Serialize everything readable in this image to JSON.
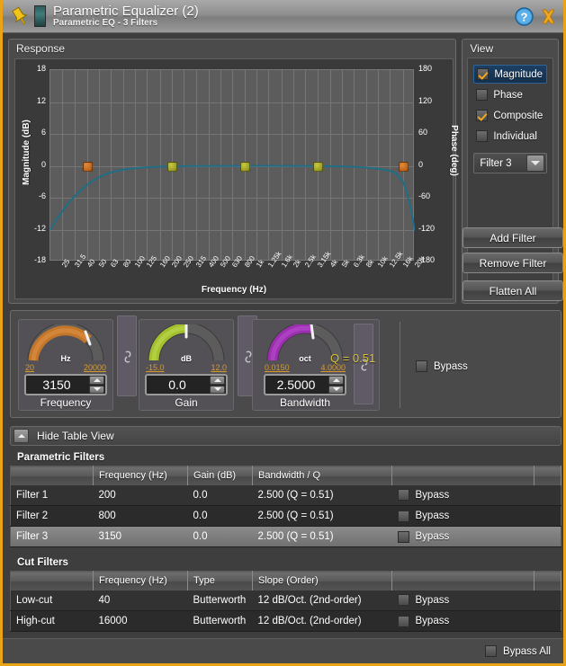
{
  "titlebar": {
    "title": "Parametric Equalizer (2)",
    "subtitle": "Parametric EQ - 3 Filters",
    "help_icon": "help-icon",
    "close_icon": "close-icon",
    "pin_icon": "pin-icon"
  },
  "response": {
    "panel_title": "Response"
  },
  "view": {
    "panel_title": "View",
    "items": [
      {
        "label": "Magnitude",
        "checked": true,
        "selected": true
      },
      {
        "label": "Phase",
        "checked": false,
        "selected": false
      },
      {
        "label": "Composite",
        "checked": true,
        "selected": false
      },
      {
        "label": "Individual",
        "checked": false,
        "selected": false
      }
    ],
    "filter_select": "Filter 3"
  },
  "buttons": {
    "add_filter": "Add Filter",
    "remove_filter": "Remove Filter",
    "flatten_all": "Flatten All"
  },
  "knobs": {
    "frequency": {
      "name": "Frequency",
      "unit": "Hz",
      "min": "20",
      "max": "20000",
      "value": "3150",
      "arc_color": "#c2762a",
      "fill_ratio": 0.66
    },
    "gain": {
      "name": "Gain",
      "unit": "dB",
      "min": "-15.0",
      "max": "12.0",
      "value": "0.0",
      "arc_color": "#a3bf2e",
      "fill_ratio": 0.55
    },
    "bandwidth": {
      "name": "Bandwidth",
      "unit": "oct",
      "min": "0.0150",
      "max": "4.0000",
      "value": "2.5000",
      "arc_color": "#9b2fb0",
      "fill_ratio": 0.62
    },
    "q_readout": "Q = 0.51",
    "bypass_label": "Bypass",
    "bypass_checked": false,
    "link_icon": "link-icon"
  },
  "table_view": {
    "toggle_label": "Hide Table View",
    "collapse_icon": "chevron-up-icon",
    "parametric": {
      "caption": "Parametric Filters",
      "headers": [
        "",
        "Frequency (Hz)",
        "Gain (dB)",
        "Bandwidth / Q",
        "",
        ""
      ],
      "rows": [
        {
          "name": "Filter 1",
          "frequency": "200",
          "gain": "0.0",
          "bandwidth": "2.500 (Q = 0.51)",
          "bypass": "Bypass",
          "bypass_checked": false,
          "selected": false
        },
        {
          "name": "Filter 2",
          "frequency": "800",
          "gain": "0.0",
          "bandwidth": "2.500 (Q = 0.51)",
          "bypass": "Bypass",
          "bypass_checked": false,
          "selected": false
        },
        {
          "name": "Filter 3",
          "frequency": "3150",
          "gain": "0.0",
          "bandwidth": "2.500 (Q = 0.51)",
          "bypass": "Bypass",
          "bypass_checked": false,
          "selected": true
        }
      ]
    },
    "cut": {
      "caption": "Cut Filters",
      "headers": [
        "",
        "Frequency (Hz)",
        "Type",
        "Slope (Order)",
        "",
        ""
      ],
      "rows": [
        {
          "name": "Low-cut",
          "frequency": "40",
          "type": "Butterworth",
          "slope": "12 dB/Oct. (2nd-order)",
          "bypass": "Bypass",
          "bypass_checked": false,
          "selected": false
        },
        {
          "name": "High-cut",
          "frequency": "16000",
          "type": "Butterworth",
          "slope": "12 dB/Oct. (2nd-order)",
          "bypass": "Bypass",
          "bypass_checked": false,
          "selected": false
        }
      ]
    }
  },
  "footer": {
    "bypass_all": "Bypass All",
    "bypass_all_checked": false
  },
  "colors": {
    "accent_border": "#e8a317",
    "curve": "#1f6e86",
    "marker_cut": "#c0651c",
    "marker_peq": "#9aa024",
    "range_text": "#d79a2b",
    "q_text": "#d7c23a"
  },
  "chart_data": {
    "type": "line",
    "title": "Response",
    "xlabel": "Frequency (Hz)",
    "ylabel": "Magnitude (dB)",
    "y2label": "Phase (deg)",
    "xscale": "log",
    "xlim": [
      20,
      20000
    ],
    "ylim": [
      -18,
      18
    ],
    "y2lim": [
      -180,
      180
    ],
    "yticks": [
      18,
      12,
      6,
      0,
      -6,
      -12,
      -18
    ],
    "y2ticks": [
      180,
      120,
      60,
      0,
      -60,
      -120,
      -180
    ],
    "xticks": [
      "25",
      "31.5",
      "40",
      "50",
      "63",
      "80",
      "100",
      "125",
      "160",
      "200",
      "250",
      "315",
      "400",
      "500",
      "630",
      "800",
      "1k",
      "1.25k",
      "1.6k",
      "2k",
      "2.5k",
      "3.15k",
      "4k",
      "5k",
      "6.3k",
      "8k",
      "10k",
      "12.5k",
      "16k",
      "20k"
    ],
    "grid": true,
    "legend": "none",
    "series": [
      {
        "name": "Composite Magnitude",
        "color": "#1f6e86",
        "x": [
          20,
          22,
          25,
          28,
          31.5,
          36,
          40,
          45,
          50,
          57,
          63,
          71,
          80,
          90,
          100,
          125,
          160,
          200,
          315,
          500,
          800,
          1250,
          2000,
          3150,
          5000,
          6300,
          8000,
          10000,
          12500,
          14000,
          16000,
          17000,
          18000,
          19000,
          20000
        ],
        "y": [
          -12.0,
          -10.4,
          -8.6,
          -7.1,
          -5.8,
          -4.5,
          -3.6,
          -2.8,
          -2.2,
          -1.6,
          -1.25,
          -0.95,
          -0.72,
          -0.55,
          -0.44,
          -0.28,
          -0.17,
          -0.11,
          -0.05,
          -0.02,
          -0.01,
          -0.01,
          -0.02,
          -0.04,
          -0.12,
          -0.2,
          -0.33,
          -0.55,
          -0.95,
          -1.4,
          -3.0,
          -4.6,
          -6.8,
          -9.4,
          -12.3
        ]
      }
    ],
    "markers": [
      {
        "label": "Low-cut",
        "freq": 40,
        "gain": 0,
        "kind": "cut"
      },
      {
        "label": "Filter 1",
        "freq": 200,
        "gain": 0,
        "kind": "peq"
      },
      {
        "label": "Filter 2",
        "freq": 800,
        "gain": 0,
        "kind": "peq"
      },
      {
        "label": "Filter 3",
        "freq": 3150,
        "gain": 0,
        "kind": "peq"
      },
      {
        "label": "High-cut",
        "freq": 16000,
        "gain": 0,
        "kind": "cut"
      }
    ]
  }
}
